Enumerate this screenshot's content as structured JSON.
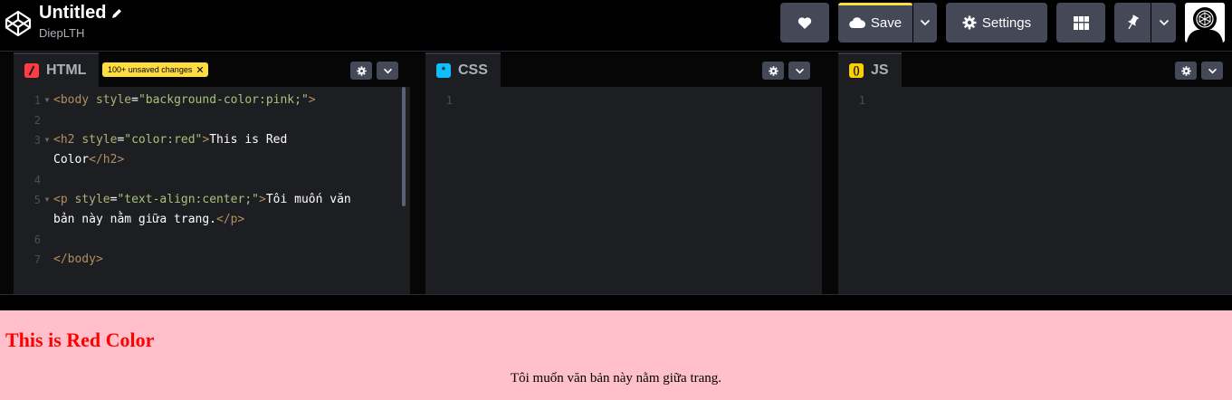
{
  "header": {
    "title": "Untitled",
    "subtitle": "DiepLTH",
    "save_label": "Save",
    "settings_label": "Settings",
    "accent": "#ffdd40"
  },
  "panes": {
    "html": {
      "label": "HTML",
      "badge": "100+ unsaved changes",
      "icon_color": "#ff3c41"
    },
    "css": {
      "label": "CSS",
      "icon_color": "#0ebeff"
    },
    "js": {
      "label": "JS",
      "icon_color": "#fcd000"
    }
  },
  "html_code": {
    "numbers": [
      "1",
      "2",
      "3",
      "4",
      "5",
      "6",
      "7"
    ],
    "l1_tag_open": "<body ",
    "l1_attr": "style",
    "l1_eq": "=",
    "l1_str": "\"background-color:pink;\"",
    "l1_tag_close": ">",
    "l3_tag_open": "<h2 ",
    "l3_attr": "style",
    "l3_eq": "=",
    "l3_str": "\"color:red\"",
    "l3_tag_close": ">",
    "l3_text": "This is Red",
    "l3b_text": "Color",
    "l3b_tag": "</h2>",
    "l5_tag_open": "<p ",
    "l5_attr": "style",
    "l5_eq": "=",
    "l5_str": "\"text-align:center;\"",
    "l5_tag_close": ">",
    "l5_text": "Tôi muốn văn",
    "l5b_text": "bản này nằm giữa trang.",
    "l5b_tag": "</p>",
    "l7_tag": "</body>"
  },
  "css_code": {
    "numbers": [
      "1"
    ]
  },
  "js_code": {
    "numbers": [
      "1"
    ]
  },
  "preview": {
    "heading": "This is Red Color",
    "paragraph": "Tôi muốn văn bản này nằm giữa trang.",
    "background": "pink",
    "heading_color": "red"
  }
}
